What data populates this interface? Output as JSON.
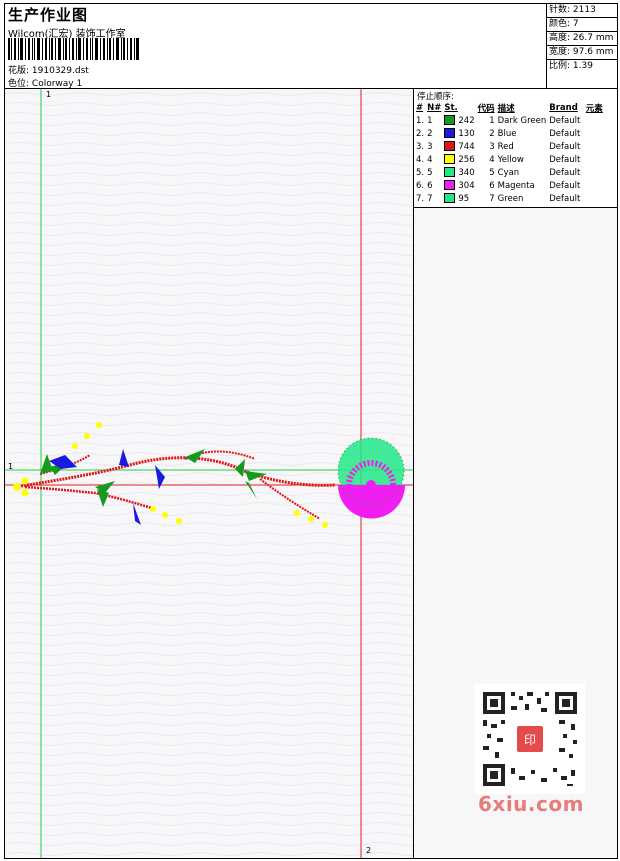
{
  "header": {
    "title": "生产作业图",
    "company": "Wilcom(汇宏) 装饰工作室",
    "design_label": "花版:",
    "design_file": "1910329.dst",
    "colorway_label": "色位:",
    "colorway": "Colorway 1"
  },
  "stats": [
    {
      "label": "针数:",
      "value": "2113"
    },
    {
      "label": "颜色:",
      "value": "7"
    },
    {
      "label": "高度:",
      "value": "26.7 mm"
    },
    {
      "label": "宽度:",
      "value": "97.6 mm"
    },
    {
      "label": "比例:",
      "value": "1.39"
    }
  ],
  "legend": {
    "caption": "停止顺序:",
    "headers": [
      "#",
      "N#",
      "St.",
      "代码",
      "描述",
      "Brand",
      "元素"
    ],
    "rows": [
      {
        "num": "1.",
        "n": "1",
        "color": "#159a1e",
        "stitches": "242",
        "code": "1",
        "desc": "Dark Green",
        "brand": "Default"
      },
      {
        "num": "2.",
        "n": "2",
        "color": "#1a1ae0",
        "stitches": "130",
        "code": "2",
        "desc": "Blue",
        "brand": "Default"
      },
      {
        "num": "3.",
        "n": "3",
        "color": "#e01414",
        "stitches": "744",
        "code": "3",
        "desc": "Red",
        "brand": "Default"
      },
      {
        "num": "4.",
        "n": "4",
        "color": "#ffff00",
        "stitches": "256",
        "code": "4",
        "desc": "Yellow",
        "brand": "Default"
      },
      {
        "num": "5.",
        "n": "5",
        "color": "#22e88a",
        "stitches": "340",
        "code": "5",
        "desc": "Cyan",
        "brand": "Default"
      },
      {
        "num": "6.",
        "n": "6",
        "color": "#f01ef0",
        "stitches": "304",
        "code": "6",
        "desc": "Magenta",
        "brand": "Default"
      },
      {
        "num": "7.",
        "n": "7",
        "color": "#22e88a",
        "stitches": "95",
        "code": "7",
        "desc": "Green",
        "brand": "Default"
      }
    ]
  },
  "canvas": {
    "guide_labels": {
      "v1": "1",
      "h1": "1",
      "v2": "2"
    }
  },
  "watermark": {
    "text": "6xiu.com",
    "qr_seal": "印"
  }
}
